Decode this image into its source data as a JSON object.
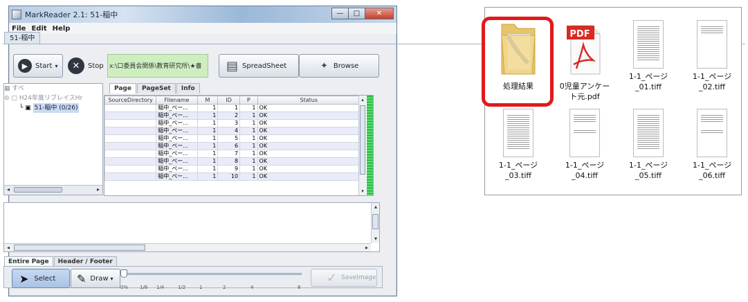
{
  "window": {
    "title": "MarkReader 2.1: 51-稲中",
    "controls": [
      "—",
      "□",
      "✕"
    ]
  },
  "menu": [
    "File",
    "Edit",
    "Help"
  ],
  "document_tab": "51-稲中",
  "toolbar": {
    "start_label": "Start",
    "stop_label": "Stop",
    "marquee_text": "x:\\口委員会関係\\教育研究所\\★書",
    "spreadsheet_label": "SpreadSheet",
    "browse_label": "Browse"
  },
  "tree": {
    "root": "すべ",
    "node1": "H24年度リブレイスHr",
    "node2": "51-稲中 (0/26)"
  },
  "table_tabs": [
    "Page",
    "PageSet",
    "Info"
  ],
  "table": {
    "headers": [
      "SourceDirectory",
      "Filename",
      "M",
      "ID",
      "P",
      "Status"
    ],
    "rows": [
      [
        "",
        "稲中_ペー...",
        "1",
        "1",
        "1",
        "OK"
      ],
      [
        "",
        "稲中_ペー...",
        "1",
        "2",
        "1",
        "OK"
      ],
      [
        "",
        "稲中_ペー...",
        "1",
        "3",
        "1",
        "OK"
      ],
      [
        "",
        "稲中_ペー...",
        "1",
        "4",
        "1",
        "OK"
      ],
      [
        "",
        "稲中_ペー...",
        "1",
        "5",
        "1",
        "OK"
      ],
      [
        "",
        "稲中_ペー...",
        "1",
        "6",
        "1",
        "OK"
      ],
      [
        "",
        "稲中_ペー...",
        "1",
        "7",
        "1",
        "OK"
      ],
      [
        "",
        "稲中_ペー...",
        "1",
        "8",
        "1",
        "OK"
      ],
      [
        "",
        "稲中_ペー...",
        "1",
        "9",
        "1",
        "OK"
      ],
      [
        "",
        "稲中_ペー...",
        "1",
        "10",
        "1",
        "OK"
      ]
    ]
  },
  "bottom_tabs": [
    "Entire Page",
    "Header / Footer"
  ],
  "bottom_tools": {
    "select_label": "Select",
    "draw_label": "Draw",
    "save_label": "SaveImage",
    "zoom_ticks": [
      "0%",
      "1/8",
      "1/4",
      "1/2",
      "1",
      "2",
      "4",
      "8"
    ]
  },
  "explorer": {
    "files": [
      {
        "name": "処理結果",
        "type": "folder"
      },
      {
        "name": "0児童アンケート元.pdf",
        "type": "pdf",
        "badge": "PDF"
      },
      {
        "name": "1-1_ページ_01.tiff",
        "type": "tiff"
      },
      {
        "name": "1-1_ページ_02.tiff",
        "type": "tiff"
      },
      {
        "name": "1-1_ページ_03.tiff",
        "type": "tiff"
      },
      {
        "name": "1-1_ページ_04.tiff",
        "type": "tiff"
      },
      {
        "name": "1-1_ページ_05.tiff",
        "type": "tiff"
      },
      {
        "name": "1-1_ページ_06.tiff",
        "type": "tiff"
      }
    ],
    "highlight_color": "#e0191c"
  }
}
